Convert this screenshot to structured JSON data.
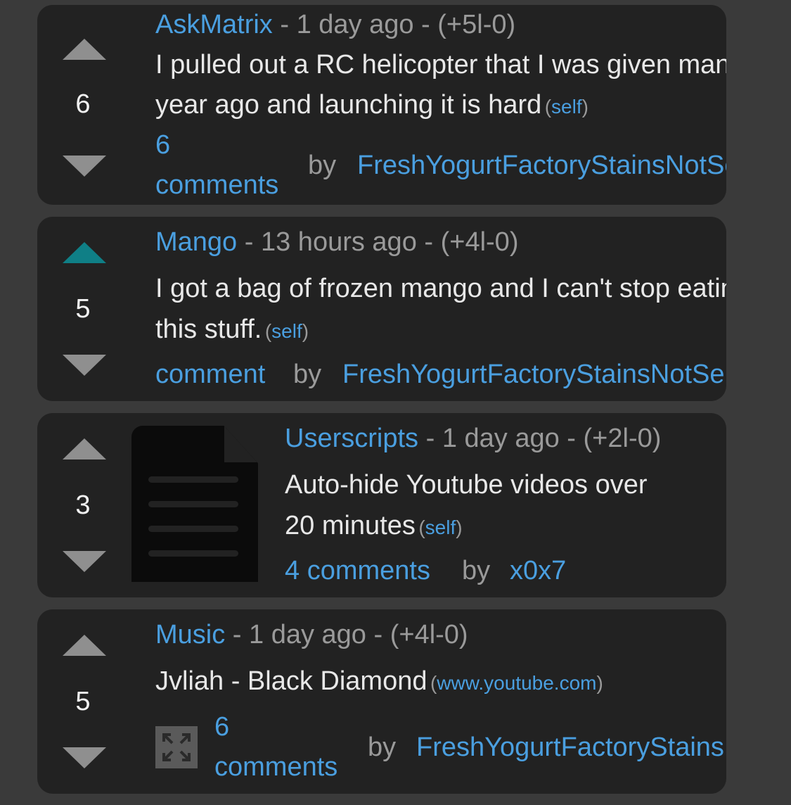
{
  "posts": [
    {
      "score": "6",
      "upvoted": false,
      "subreddit": "AskMatrix",
      "age_sep": " - ",
      "age": "1 day ago",
      "votes_sep": " - ",
      "votes": "(+5l-0)",
      "title_line1": "I pulled out a RC helicopter that I was given many",
      "title_line2": "year ago and launching it is hard",
      "domain_open": "(",
      "domain": "self",
      "domain_close": ")",
      "comments_line1": "6",
      "comments_line2": "comments",
      "by": "by",
      "author": "FreshYogurtFactoryStainsNotSemen"
    },
    {
      "score": "5",
      "upvoted": true,
      "subreddit": "Mango",
      "age_sep": " - ",
      "age": "13 hours ago",
      "votes_sep": " - ",
      "votes": "(+4l-0)",
      "title_line1": "I got a bag of frozen mango and I can't stop eating",
      "title_line2": "this stuff.",
      "domain_open": "(",
      "domain": "self",
      "domain_close": ")",
      "comments": "comment",
      "by": "by",
      "author": "FreshYogurtFactoryStainsNotSemen"
    },
    {
      "score": "3",
      "upvoted": false,
      "thumbnail_icon": "document-icon",
      "subreddit": "Userscripts",
      "age_sep": " - ",
      "age": "1 day ago",
      "votes_sep": " - ",
      "votes": "(+2l-0)",
      "title_line1": "Auto-hide Youtube videos over",
      "title_line2": "20 minutes",
      "domain_open": "(",
      "domain": "self",
      "domain_close": ")",
      "comments": "4 comments",
      "by": "by",
      "author": "x0x7"
    },
    {
      "score": "5",
      "upvoted": false,
      "expand_icon": "expand-icon",
      "subreddit": "Music",
      "age_sep": " - ",
      "age": "1 day ago",
      "votes_sep": " - ",
      "votes": "(+4l-0)",
      "title_line1": "Jvliah - Black Diamond",
      "domain_open": "(",
      "domain": "www.youtube.com",
      "domain_close": ")",
      "comments_line1": "6",
      "comments_line2": "comments",
      "by": "by",
      "author": "FreshYogurtFactoryStainsNotSemen"
    }
  ],
  "colors": {
    "page_bg": "#3a3a3a",
    "card_bg": "#222222",
    "link": "#4a9fe0",
    "arrow": "#8f8f8f",
    "arrow_active": "#0f7f86",
    "meta": "#9a9a9a"
  }
}
